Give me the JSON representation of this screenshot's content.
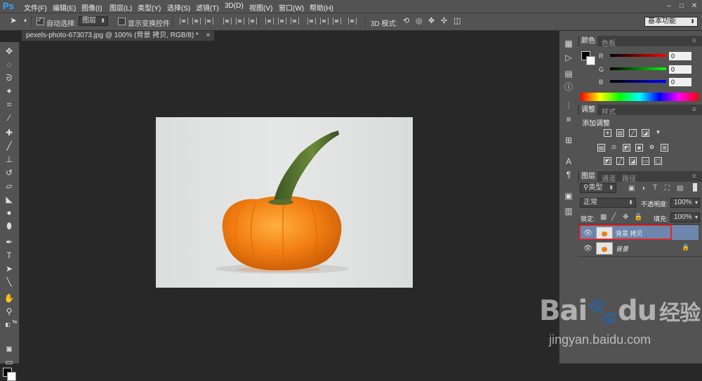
{
  "app": {
    "logo": "Ps"
  },
  "menu": [
    "文件(F)",
    "编辑(E)",
    "图像(I)",
    "图层(L)",
    "类型(Y)",
    "选择(S)",
    "滤镜(T)",
    "3D(D)",
    "视图(V)",
    "窗口(W)",
    "帮助(H)"
  ],
  "window_controls": [
    "–",
    "□",
    "✕"
  ],
  "options": {
    "auto_select_label": "自动选择:",
    "auto_select_value": "图层",
    "show_transform_label": "显示变换控件",
    "mode_3d_label": "3D 模式:",
    "workspace": "基本功能"
  },
  "document": {
    "tab_title": "pexels-photo-673073.jpg @ 100% (背景 拷贝, RGB/8) *",
    "close": "×"
  },
  "color_panel": {
    "tabs": [
      "颜色",
      "色板"
    ],
    "channels": [
      {
        "label": "R",
        "value": "0"
      },
      {
        "label": "G",
        "value": "0"
      },
      {
        "label": "B",
        "value": "0"
      }
    ]
  },
  "adjust_panel": {
    "tabs": [
      "调整",
      "样式"
    ],
    "heading": "添加调整"
  },
  "layers_panel": {
    "tabs": [
      "图层",
      "通道",
      "路径"
    ],
    "filter_kind": "类型",
    "blend_mode": "正常",
    "opacity_label": "不透明度:",
    "opacity_value": "100%",
    "lock_label": "锁定:",
    "fill_label": "填充:",
    "fill_value": "100%",
    "layers": [
      {
        "name": "背景 拷贝",
        "selected": true,
        "locked": false
      },
      {
        "name": "背景",
        "selected": false,
        "locked": true
      }
    ]
  },
  "watermark": {
    "brand": "Bai",
    "brand2": "du",
    "suffix": "经验",
    "url": "jingyan.baidu.com"
  },
  "colors": {
    "accent_highlight": "#e0262a",
    "selected_layer": "#6e86ad",
    "pumpkin": "#f07b0f",
    "stem": "#4c6b2a"
  }
}
